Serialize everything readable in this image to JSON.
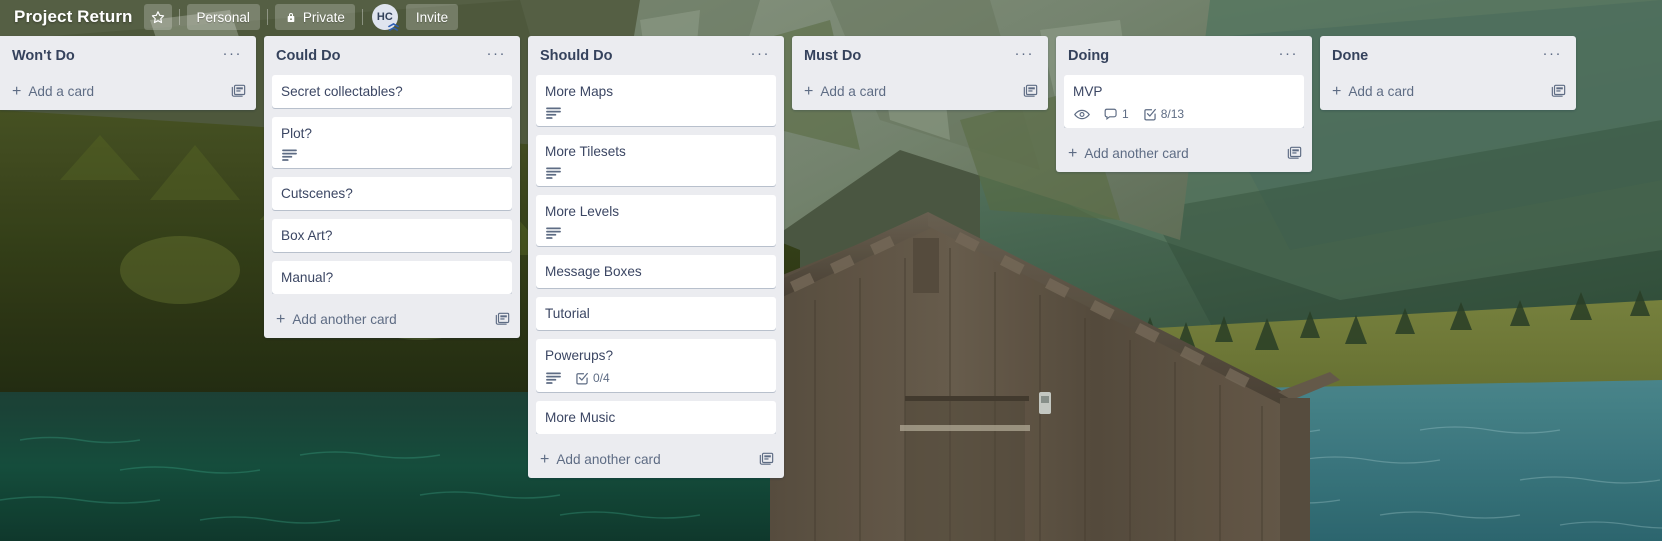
{
  "header": {
    "title": "Project Return",
    "star_icon": "star-icon",
    "workspace_label": "Personal",
    "visibility_label": "Private",
    "visibility_icon": "lock-icon",
    "avatar_initials": "HC",
    "invite_label": "Invite"
  },
  "board": {
    "add_a_card_label": "Add a card",
    "add_another_card_label": "Add another card",
    "list_menu_glyph": "···",
    "template_icon": "card-template-icon",
    "accent_text_color": "#3b4663",
    "list_background": "#ebecf0",
    "card_background": "#ffffff",
    "lists": [
      {
        "title": "Won't Do",
        "add_label": "Add a card",
        "has_template_icon": true,
        "cards": []
      },
      {
        "title": "Could Do",
        "add_label": "Add another card",
        "has_template_icon": true,
        "cards": [
          {
            "title": "Secret collectables?",
            "badges": []
          },
          {
            "title": "Plot?",
            "badges": [
              {
                "icon": "description-icon",
                "value": ""
              }
            ]
          },
          {
            "title": "Cutscenes?",
            "badges": []
          },
          {
            "title": "Box Art?",
            "badges": []
          },
          {
            "title": "Manual?",
            "badges": []
          }
        ]
      },
      {
        "title": "Should Do",
        "add_label": "Add another card",
        "has_template_icon": true,
        "cards": [
          {
            "title": "More Maps",
            "badges": [
              {
                "icon": "description-icon",
                "value": ""
              }
            ]
          },
          {
            "title": "More Tilesets",
            "badges": [
              {
                "icon": "description-icon",
                "value": ""
              }
            ]
          },
          {
            "title": "More Levels",
            "badges": [
              {
                "icon": "description-icon",
                "value": ""
              }
            ]
          },
          {
            "title": "Message Boxes",
            "badges": []
          },
          {
            "title": "Tutorial",
            "badges": []
          },
          {
            "title": "Powerups?",
            "badges": [
              {
                "icon": "description-icon",
                "value": ""
              },
              {
                "icon": "checklist-icon",
                "value": "0/4"
              }
            ]
          },
          {
            "title": "More Music",
            "badges": []
          }
        ]
      },
      {
        "title": "Must Do",
        "add_label": "Add a card",
        "has_template_icon": true,
        "cards": []
      },
      {
        "title": "Doing",
        "add_label": "Add another card",
        "has_template_icon": true,
        "cards": [
          {
            "title": "MVP",
            "badges": [
              {
                "icon": "watch-eye-icon",
                "value": ""
              },
              {
                "icon": "comment-icon",
                "value": "1"
              },
              {
                "icon": "checklist-icon",
                "value": "8/13"
              }
            ]
          }
        ]
      },
      {
        "title": "Done",
        "add_label": "Add a card",
        "has_template_icon": true,
        "cards": []
      }
    ]
  }
}
